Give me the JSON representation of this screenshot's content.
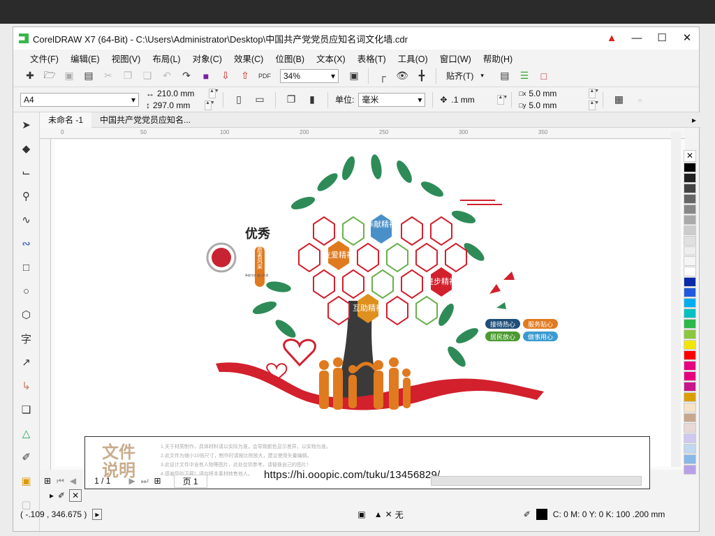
{
  "window": {
    "title": "CorelDRAW X7 (64-Bit) - C:\\Users\\Administrator\\Desktop\\中国共产党党员应知名词文化墙.cdr",
    "buttons": [
      "minimize",
      "maximize",
      "close"
    ]
  },
  "menu": [
    "文件(F)",
    "编辑(E)",
    "视图(V)",
    "布局(L)",
    "对象(C)",
    "效果(C)",
    "位图(B)",
    "文本(X)",
    "表格(T)",
    "工具(O)",
    "窗口(W)",
    "帮助(H)"
  ],
  "toolbar": {
    "zoom": "34%",
    "snap_label": "贴齐(T)"
  },
  "propbar": {
    "page_size": "A4",
    "width": "210.0 mm",
    "height": "297.0 mm",
    "unit_label": "单位:",
    "unit": "毫米",
    "nudge": ".1 mm",
    "dup_x": "5.0 mm",
    "dup_y": "5.0 mm"
  },
  "tabs": [
    "未命名 -1",
    "中国共产党党员应知名..."
  ],
  "artwork": {
    "heading": "优秀",
    "subheading": "志愿者风采",
    "small_text": "奉献守护 爱心传递",
    "hex_labels": [
      "奉献精神",
      "友爱精神",
      "进步精神",
      "互助精神"
    ],
    "pills": [
      {
        "text": "接待热心",
        "color": "#1f4e79"
      },
      {
        "text": "服务贴心",
        "color": "#e07a1f"
      },
      {
        "text": "居民放心",
        "color": "#4a9a2f"
      },
      {
        "text": "做事用心",
        "color": "#3b9bd1"
      }
    ]
  },
  "description": {
    "title": "文件说明",
    "lines": [
      "1.关于材质制作，具体材料请以实际为准，会导致颜色显示差异，以实物为准。",
      "2.此文件为缩小10倍尺寸，制作时请按比例放大，建议使用矢量编辑。",
      "3.此设计文件中含有人物等图片，此处仅供参考，请替换自己的图片！",
      "4.感谢您的下载！请勿将本素材转售他人。"
    ],
    "url": "https://hi.ooopic.com/tuku/13456829/"
  },
  "navigator": {
    "page_count": "1 / 1",
    "page_tab": "页 1"
  },
  "status": {
    "coords": "( -.109 , 346.675 )",
    "fill_label": "无",
    "outline": "C: 0 M: 0 Y: 0 K: 100  .200 mm"
  },
  "palette": [
    "#ffffff",
    "#000000",
    "#222222",
    "#444444",
    "#666666",
    "#888888",
    "#aaaaaa",
    "#cccccc",
    "#e0e0e0",
    "#eeeeee",
    "#f5f5f5",
    "#ffffff",
    "#0a2aa8",
    "#1f5bdc",
    "#00aeef",
    "#00c0c0",
    "#2db84b",
    "#8dc63f",
    "#f2e600",
    "#ff0000",
    "#e4007f",
    "#e6007e",
    "#c7168a",
    "#d9a000",
    "#f7e3c8",
    "#c8a78f",
    "#e8d8d8",
    "#d0c8f0",
    "#c0d8f0",
    "#88b8e8",
    "#b8a0e8"
  ],
  "colors": {
    "accent_red": "#d2202d",
    "tree_green": "#2e8b57",
    "trunk": "#3a3a3a",
    "people": "#e07a1f"
  }
}
